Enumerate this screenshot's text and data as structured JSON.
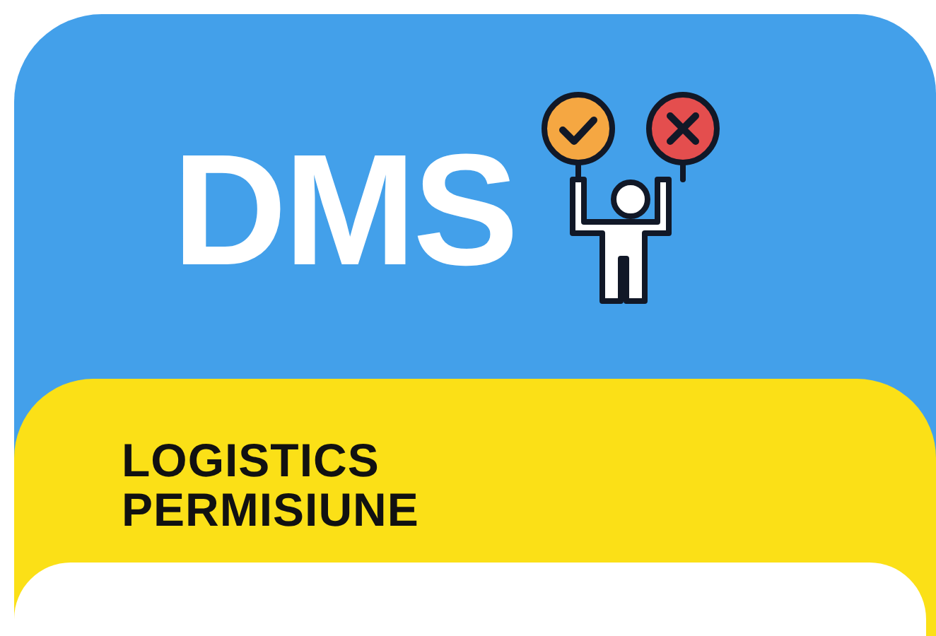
{
  "header": {
    "logo": "DMS"
  },
  "banner": {
    "title_lines": [
      "LOGISTICS",
      "PERMISIUNE"
    ]
  }
}
